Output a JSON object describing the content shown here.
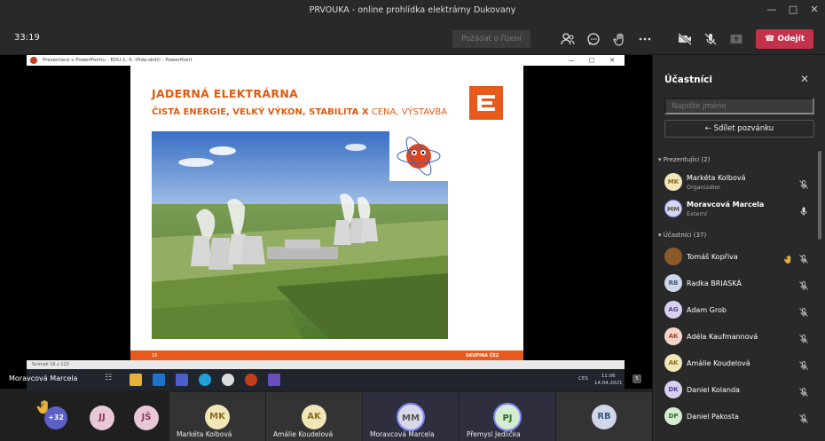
{
  "window": {
    "title": "PRVOUKA - online prohlídka elektrárny Dukovany"
  },
  "toolbar": {
    "timer": "33:19",
    "request_label": "Požádat o řízení",
    "leave_label": "Odejít"
  },
  "powerpoint": {
    "window_title": "Prezentace v PowerPointu - EDU-1.-5. třída-sklíčí - PowerPoint",
    "status": "Snímek 16 z 120",
    "slide": {
      "heading": "JADERNÁ ELEKTRÁRNA",
      "subheading_bold": "ČISTÁ ENERGIE, VELKÝ VÝKON, STABILITA X",
      "subheading_light": " CENA, VÝSTAVBA",
      "page_number": "16",
      "footer_brand": "SKUPINA ČEZ"
    }
  },
  "taskbar": {
    "lang": "CES",
    "time": "11:06",
    "date": "14.04.2021",
    "notif": "5"
  },
  "presenter_tag": "Moravcová Marcela",
  "strip": {
    "raised_count": "+32",
    "tiles": [
      {
        "initials": "JJ",
        "name": ""
      },
      {
        "initials": "JŠ",
        "name": ""
      },
      {
        "initials": "MK",
        "name": "Markéta Kolbová"
      },
      {
        "initials": "AK",
        "name": "Amálie Koudelová"
      },
      {
        "initials": "MM",
        "name": "Moravcová Marcela"
      },
      {
        "initials": "PJ",
        "name": "Přemysl Jedlička"
      },
      {
        "initials": "RB",
        "name": ""
      }
    ]
  },
  "panel": {
    "title": "Účastníci",
    "search_placeholder": "Napište jméno",
    "share_label": "Sdílet pozvánku",
    "presenters_header": "Prezentující (2)",
    "attendees_header": "Účastníci (37)",
    "presenters": [
      {
        "initials": "MK",
        "name": "Markéta Kolbová",
        "role": "Organizátor"
      },
      {
        "initials": "MM",
        "name": "Moravcová Marcela",
        "role": "Externí"
      }
    ],
    "attendees": [
      {
        "initials": "",
        "name": "Tomáš Kopřiva"
      },
      {
        "initials": "RB",
        "name": "Radka BRIASKÁ"
      },
      {
        "initials": "AG",
        "name": "Adam Grob"
      },
      {
        "initials": "AK",
        "name": "Adéla Kaufmannová"
      },
      {
        "initials": "AK",
        "name": "Amálie Koudelová"
      },
      {
        "initials": "DK",
        "name": "Daniel Kolanda"
      },
      {
        "initials": "DP",
        "name": "Daniel Pakosta"
      }
    ]
  },
  "colors": {
    "accent_orange": "#e85a1b",
    "leave_red": "#c4314b"
  }
}
